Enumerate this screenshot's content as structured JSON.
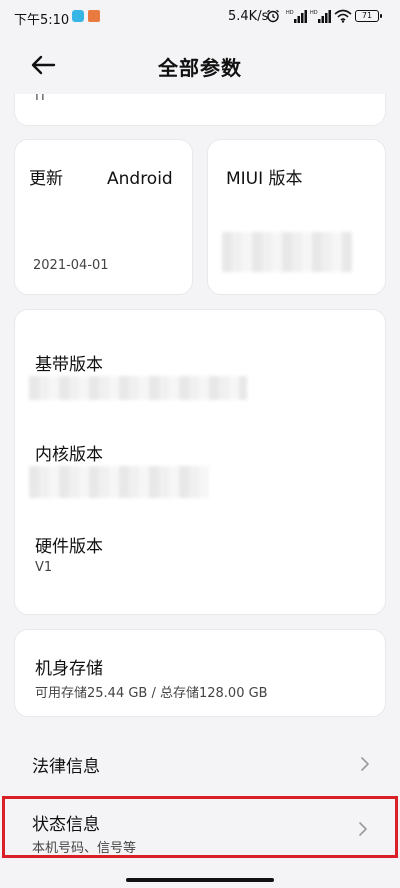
{
  "status_bar": {
    "time": "下午5:10",
    "net_speed": "5.4K/s",
    "battery": "71",
    "icons": [
      "app-notification-icon",
      "app-notification-icon",
      "alarm-icon",
      "signal-icon",
      "signal-icon",
      "wifi-icon",
      "battery-icon"
    ]
  },
  "header": {
    "title": "全部参数",
    "back_icon": "arrow-left-icon"
  },
  "cards": {
    "top_partial": {
      "text": "П"
    },
    "android": {
      "title_left": "更新",
      "title_right": "Android",
      "date": "2021-04-01"
    },
    "miui": {
      "title": "MIUI 版本"
    },
    "versions": {
      "baseband_label": "基带版本",
      "kernel_label": "内核版本",
      "hardware_label": "硬件版本",
      "hardware_value": "V1"
    },
    "storage": {
      "label": "机身存储",
      "detail": "可用存储25.44 GB / 总存储128.00 GB"
    }
  },
  "rows": {
    "legal": {
      "label": "法律信息"
    },
    "status": {
      "label": "状态信息",
      "sub": "本机号码、信号等"
    }
  },
  "colors": {
    "background": "#f4f4f6",
    "card": "#ffffff",
    "highlight_border": "#d92027"
  }
}
